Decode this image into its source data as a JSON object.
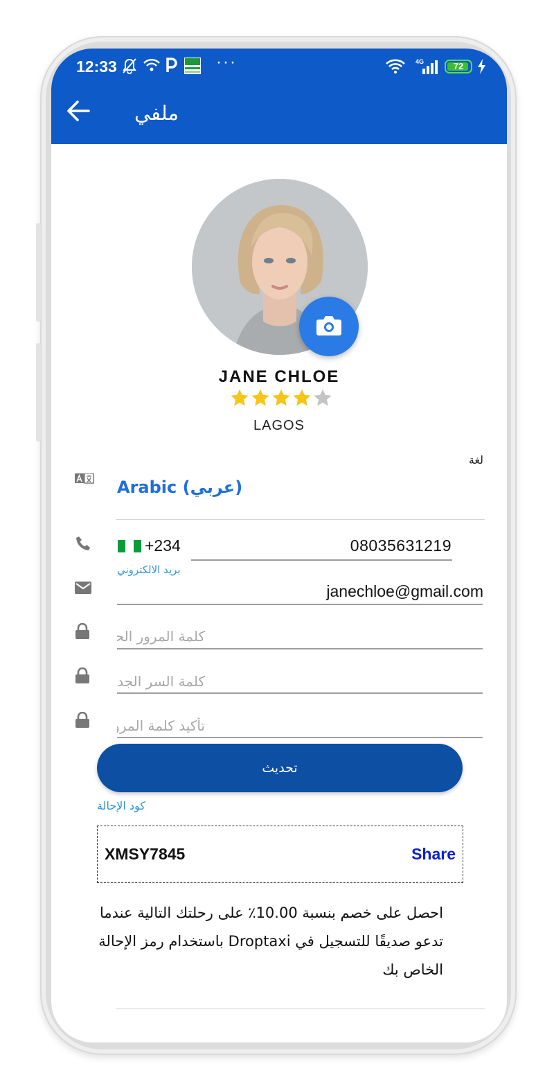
{
  "status_bar": {
    "time": "12:33",
    "icons": [
      "bell-off-icon",
      "wifi-call-icon",
      "parking-icon",
      "app-badge-icon",
      "more-dots-icon",
      "wifi-icon",
      "signal-4g-icon",
      "battery-icon",
      "charging-icon"
    ],
    "more": "···",
    "network": "4G",
    "battery_level": "72"
  },
  "appbar": {
    "title": "ملفي",
    "background": "#0d5ac8"
  },
  "profile": {
    "name": "JANE CHLOE",
    "rating": 4,
    "rating_max": 5,
    "city": "LAGOS"
  },
  "language": {
    "label": "لغة",
    "value": "Arabic (عربي)"
  },
  "phone": {
    "country_code": "+234",
    "number": "08035631219"
  },
  "email": {
    "label": "بريد الالكتروني",
    "value": "janechloe@gmail.com"
  },
  "passwords": {
    "current_placeholder": "كلمة المرور الحالية",
    "new_placeholder": "كلمة السر الجديدة",
    "confirm_placeholder": "تأكيد كلمة المرور"
  },
  "update_button": "تحديث",
  "referral": {
    "label": "كود الإحالة",
    "code": "XMSY7845",
    "share": "Share",
    "description": "احصل على خصم بنسبة 10.00٪ على رحلتك التالية عندما تدعو صديقًا للتسجيل في Droptaxi باستخدام رمز الإحالة الخاص بك"
  },
  "colors": {
    "primary": "#0d5ac8",
    "button": "#0d4fa3",
    "accent_link": "#1e6fdc",
    "share": "#0b1fd0",
    "star": "#f5c518"
  }
}
